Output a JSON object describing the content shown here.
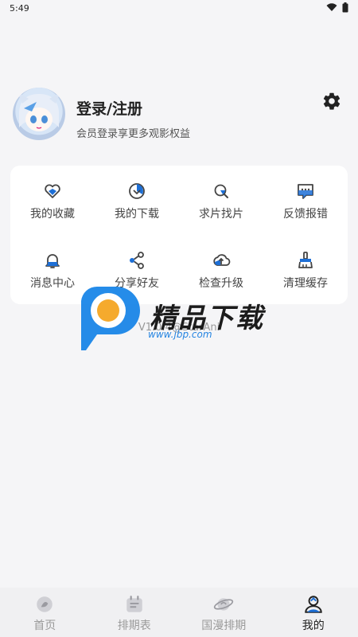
{
  "status_bar": {
    "time": "5:49"
  },
  "profile": {
    "title": "登录/注册",
    "subtitle": "会员登录享更多观影权益"
  },
  "menu": {
    "items": [
      {
        "label": "我的收藏",
        "icon": "heart-icon"
      },
      {
        "label": "我的下载",
        "icon": "download-icon"
      },
      {
        "label": "求片找片",
        "icon": "search-film-icon"
      },
      {
        "label": "反馈报错",
        "icon": "feedback-icon"
      },
      {
        "label": "消息中心",
        "icon": "bell-icon"
      },
      {
        "label": "分享好友",
        "icon": "share-icon"
      },
      {
        "label": "检查升级",
        "icon": "upgrade-icon"
      },
      {
        "label": "清理缓存",
        "icon": "broom-icon"
      }
    ]
  },
  "version": "V1.0.4@StarAni",
  "watermark": {
    "brand": "精品下载",
    "url": "www.jbp.com"
  },
  "tabs": [
    {
      "label": "首页",
      "icon": "home-icon",
      "active": false
    },
    {
      "label": "排期表",
      "icon": "calendar-icon",
      "active": false
    },
    {
      "label": "国漫排期",
      "icon": "planet-icon",
      "active": false
    },
    {
      "label": "我的",
      "icon": "profile-icon",
      "active": true
    }
  ],
  "colors": {
    "accent": "#1d6fd6",
    "icon_gray": "#555555",
    "background": "#f5f5f7"
  }
}
